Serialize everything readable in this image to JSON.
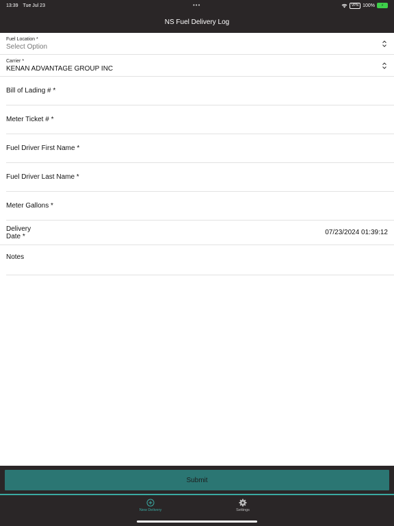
{
  "status_bar": {
    "time": "13:39",
    "date": "Tue Jul 23",
    "vpn": "VPN",
    "battery_pct": "100%"
  },
  "nav": {
    "title": "NS Fuel Delivery Log"
  },
  "form": {
    "fuel_location": {
      "label": "Fuel Location *",
      "value": "Select Option"
    },
    "carrier": {
      "label": "Carrier *",
      "value": "KENAN ADVANTAGE GROUP INC"
    },
    "bill_of_lading": {
      "placeholder": "Bill of Lading # *"
    },
    "meter_ticket": {
      "placeholder": "Meter Ticket # *"
    },
    "driver_first": {
      "placeholder": "Fuel Driver First Name *"
    },
    "driver_last": {
      "placeholder": "Fuel Driver Last Name *"
    },
    "meter_gallons": {
      "placeholder": "Meter Gallons *"
    },
    "delivery_date": {
      "label_line1": "Delivery",
      "label_line2": "Date *",
      "value": "07/23/2024 01:39:12"
    },
    "notes": {
      "placeholder": "Notes"
    }
  },
  "submit": {
    "label": "Submit"
  },
  "tabs": [
    {
      "label": "New Delivery",
      "icon": "plus-circle-icon",
      "active": true
    },
    {
      "label": "Settings",
      "icon": "gear-icon",
      "active": false
    }
  ],
  "colors": {
    "header_bg": "#2a2627",
    "accent": "#3aa9a2",
    "submit_bg": "#2b7673"
  }
}
